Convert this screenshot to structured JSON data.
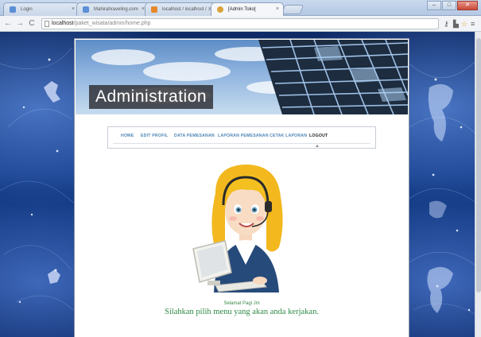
{
  "browser": {
    "tabs": [
      {
        "label": "Login",
        "active": false,
        "icon": "page-favicon"
      },
      {
        "label": "Mahirahraveling.com",
        "active": false,
        "icon": "page-favicon"
      },
      {
        "label": "localhost / localhost / ...",
        "active": false,
        "icon": "phpmyadmin-favicon"
      },
      {
        "label": "[Admin Toko]",
        "active": true,
        "icon": "user-favicon"
      }
    ],
    "window_buttons": {
      "minimize": "–",
      "maximize": "□",
      "close": "✕"
    },
    "url_host": "localhost",
    "url_path": "/paket_wisata/admin/home.php",
    "icons": {
      "back": "back-arrow-icon",
      "forward": "forward-arrow-icon",
      "reload": "reload-icon",
      "star": "star-icon",
      "menu": "menu-icon"
    }
  },
  "page": {
    "banner_title": "Administration",
    "menu": {
      "home": "HOME",
      "edit_profil": "EDIT PROFIL",
      "data_pemesanan": "DATA PEMESANAN",
      "laporan_pemesanan": "LAPORAN PEMESANAN",
      "cetak_laporan": "CETAK LAPORAN",
      "logout": "LOGOUT"
    },
    "greeting": "Selamat Pagi Jm",
    "instruction": "Silahkan pilih menu yang akan anda kerjakan."
  },
  "colors": {
    "menu_link": "#4f86b8",
    "greeting": "#2f8a46",
    "background": "#123a86"
  }
}
